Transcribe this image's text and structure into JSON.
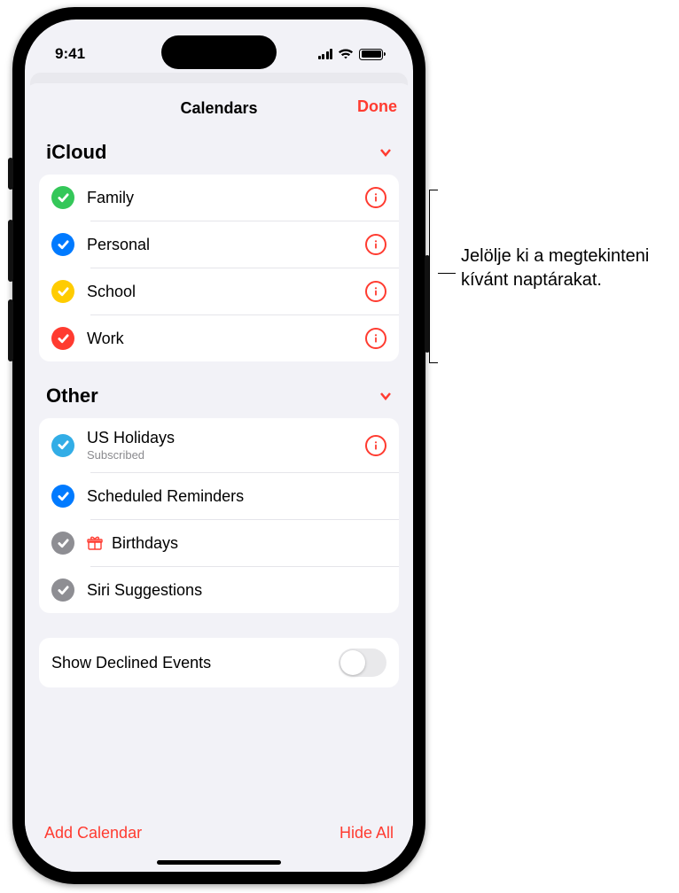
{
  "status": {
    "time": "9:41"
  },
  "sheet": {
    "title": "Calendars",
    "done": "Done"
  },
  "sections": {
    "icloud": {
      "title": "iCloud",
      "items": [
        {
          "label": "Family",
          "color": "#34c759"
        },
        {
          "label": "Personal",
          "color": "#007aff"
        },
        {
          "label": "School",
          "color": "#ffcc00"
        },
        {
          "label": "Work",
          "color": "#ff3b30"
        }
      ]
    },
    "other": {
      "title": "Other",
      "items": [
        {
          "label": "US Holidays",
          "sub": "Subscribed",
          "color": "#32ade6",
          "info": true
        },
        {
          "label": "Scheduled Reminders",
          "color": "#007aff"
        },
        {
          "label": "Birthdays",
          "color": "#8e8e93",
          "gift": true
        },
        {
          "label": "Siri Suggestions",
          "color": "#8e8e93"
        }
      ]
    }
  },
  "declined": {
    "label": "Show Declined Events",
    "on": false
  },
  "bottom": {
    "add": "Add Calendar",
    "hide": "Hide All"
  },
  "callout": "Jelölje ki a megtekinteni kívánt naptárakat."
}
